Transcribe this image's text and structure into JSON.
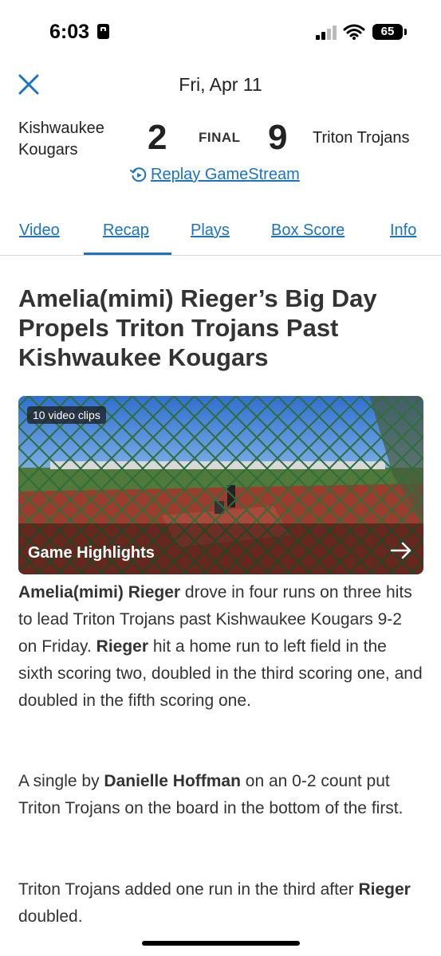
{
  "status": {
    "time": "6:03",
    "battery": "65"
  },
  "header": {
    "date": "Fri, Apr 11"
  },
  "game": {
    "away_team_line1": "Kishwaukee",
    "away_team_line2": "Kougars",
    "away_score": "2",
    "status": "FINAL",
    "home_score": "9",
    "home_team": "Triton Trojans",
    "replay_label": "Replay GameStream"
  },
  "tabs": [
    {
      "label": "Video"
    },
    {
      "label": "Recap"
    },
    {
      "label": "Plays"
    },
    {
      "label": "Box Score"
    },
    {
      "label": "Info"
    }
  ],
  "active_tab": "Recap",
  "article": {
    "headline": "Amelia(mimi) Rieger’s Big Day Propels Triton Trojans Past Kishwaukee Kougars",
    "video": {
      "clips": "10 video clips",
      "title": "Game Highlights"
    },
    "p1": {
      "b1": "Amelia(mimi) Rieger",
      "t1": " drove in four runs on three hits to lead Triton Trojans past Kishwaukee Kougars 9-2 on Friday. ",
      "b2": "Rieger",
      "t2": " hit a home run to left field in the sixth scoring two, doubled in the third scoring one, and doubled in the fifth scoring one."
    },
    "p2": {
      "t1": "A single by ",
      "b1": "Danielle Hoffman",
      "t2": " on an 0-2 count put Triton Trojans on the board in the bottom of the first."
    },
    "p3": {
      "t1": "Triton Trojans added one run in the third after ",
      "b1": "Rieger",
      "t2": " doubled."
    }
  },
  "colors": {
    "accent": "#1a74c4",
    "text": "#333333"
  }
}
